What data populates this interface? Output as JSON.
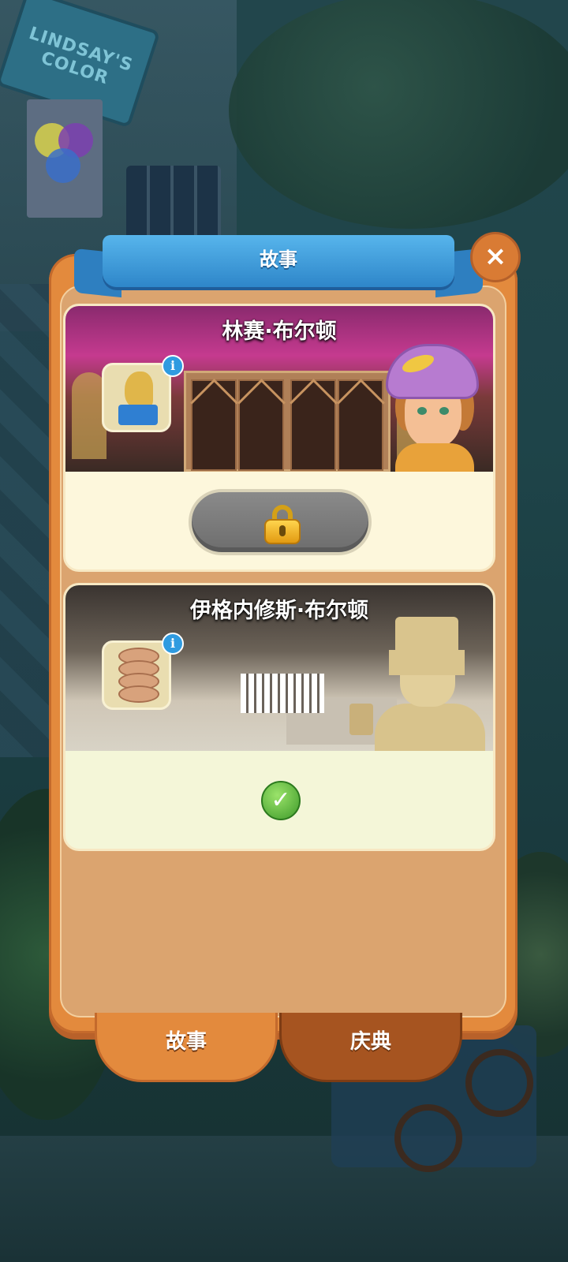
{
  "dialog": {
    "title": "故事",
    "close_label": "×"
  },
  "stories": [
    {
      "title": "林赛·布尔顿",
      "reward_icon": "trophy-icon",
      "status": "locked",
      "status_icon": "lock-icon"
    },
    {
      "title": "伊格内修斯·布尔顿",
      "reward_icon": "tin-cans-icon",
      "status": "completed",
      "status_icon": "checkmark-icon",
      "check_glyph": "✓"
    }
  ],
  "info_glyph": "i",
  "tabs": [
    {
      "label": "故事",
      "active": true
    },
    {
      "label": "庆典",
      "active": false
    }
  ],
  "background": {
    "shop_sign": "LINDSAY'S COLOR"
  },
  "colors": {
    "frame": "#e38a3d",
    "ribbon": "#3b95d6",
    "locked_button": "#7d7d7d",
    "check_green": "#3e9a2a"
  }
}
